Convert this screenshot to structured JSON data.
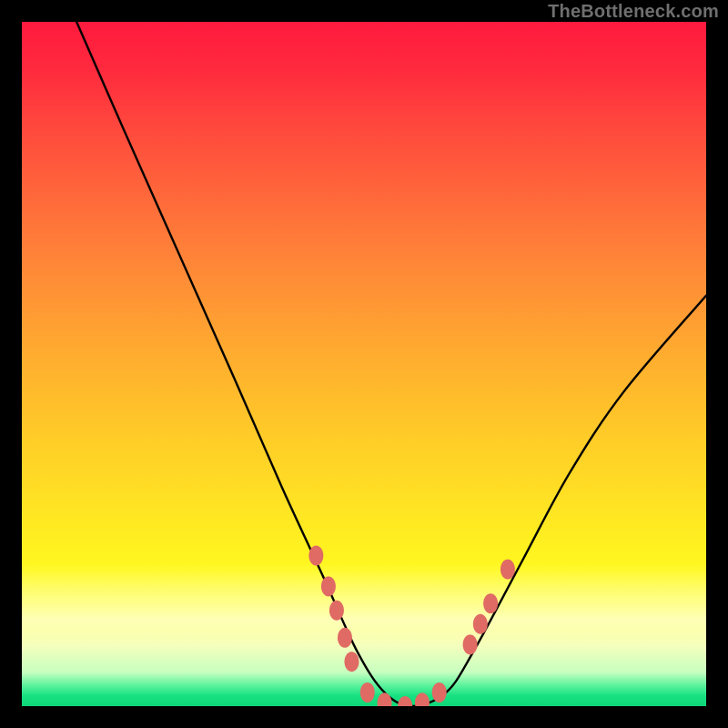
{
  "watermark": "TheBottleneck.com",
  "chart_data": {
    "type": "line",
    "title": "",
    "xlabel": "",
    "ylabel": "",
    "xlim": [
      0,
      100
    ],
    "ylim": [
      0,
      100
    ],
    "grid": false,
    "series": [
      {
        "name": "curve",
        "color": "#000000",
        "x": [
          8,
          15,
          23,
          31,
          38,
          44,
          49,
          53,
          57,
          62,
          66,
          73,
          80,
          88,
          100
        ],
        "y": [
          100,
          84,
          66,
          48,
          32,
          19,
          8,
          2,
          0,
          2,
          8,
          21,
          34,
          46,
          60
        ]
      }
    ],
    "annotations": {
      "beads": {
        "color": "#e06a64",
        "points": [
          {
            "x": 43,
            "y": 22
          },
          {
            "x": 44.8,
            "y": 17.5
          },
          {
            "x": 46,
            "y": 14
          },
          {
            "x": 47.2,
            "y": 10
          },
          {
            "x": 48.2,
            "y": 6.5
          },
          {
            "x": 50.5,
            "y": 2
          },
          {
            "x": 53,
            "y": 0.5
          },
          {
            "x": 56,
            "y": 0
          },
          {
            "x": 58.5,
            "y": 0.5
          },
          {
            "x": 61,
            "y": 2
          },
          {
            "x": 65.5,
            "y": 9
          },
          {
            "x": 67,
            "y": 12
          },
          {
            "x": 68.5,
            "y": 15
          },
          {
            "x": 71,
            "y": 20
          }
        ]
      }
    }
  }
}
